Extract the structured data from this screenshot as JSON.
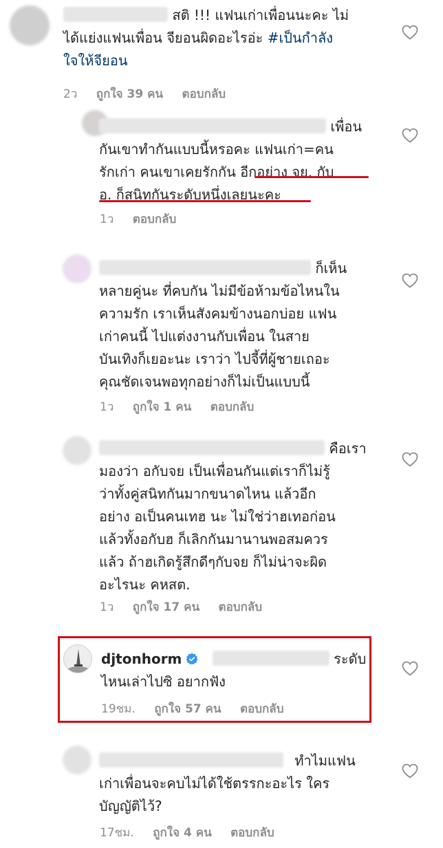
{
  "comments": [
    {
      "lines": [
        "สติ !!! แฟนเก่าเพื่อนนะคะ ไม่",
        "ได้แย่งแฟนเพื่อน จียอนผิดอะไรอ่ะ",
        "ใจให้จียอน"
      ],
      "hashtag": "#เป็นกำลัง",
      "time": "2ว",
      "likes": "ถูกใจ 39 คน",
      "reply": "ตอบกลับ"
    },
    {
      "lines": [
        "เพื่อน",
        "กันเขาทำกันแบบนี้หรอคะ แฟนเก่า=คน",
        "รักเก่า คนเขาเคยรักกัน",
        "อีกอย่าง จย. กับ",
        "อ. ก็สนิทกันระดับหนึ่งเลยนะคะ"
      ],
      "time": "1ว",
      "reply": "ตอบกลับ"
    },
    {
      "lines": [
        "ก็เห็น",
        "หลายคู่นะ ที่คบกัน  ไม่มีข้อห้ามข้อไหนใน",
        "ความรัก  เราเห็นสังคมข้างนอกบ่อย แฟน",
        "เก่าคนนี้ ไปแต่งงานกับเพื่อน  ในสาย",
        "บันเทิงก็เยอะนะ  เราว่า ไปจี้ที่ผู้ชายเถอะ",
        "คุณชัดเจนพอทุกอย่างก็ไม่เป็นแบบนี้"
      ],
      "time": "1ว",
      "likes": "ถูกใจ 1 คน",
      "reply": "ตอบกลับ"
    },
    {
      "lines": [
        "คือเรา",
        "มองว่า อกับจย เป็นเพื่อนกันแต่เราก็ไม่รู้",
        "ว่าทั้งคู่สนิทกันมากขนาดไหน แล้วอีก",
        "อย่าง อเป็นคนเทฮ นะ ไม่ใช่ว่าฮเทอก่อน",
        "แล้วทั้งอกับฮ ก็เลิกกันมานานพอสมควร",
        "แล้ว ถ้าฮเกิดรู้สึกดีๆกับจย ก็ไม่น่าจะผิด",
        "อะไรนะ คหสต."
      ],
      "time": "1ว",
      "likes": "ถูกใจ 17 คน",
      "reply": "ตอบกลับ"
    },
    {
      "username": "djtonhorm",
      "lines": [
        "ระดับ",
        "ไหนเล่าไปซิ อยากฟัง"
      ],
      "time": "19ชม.",
      "likes": "ถูกใจ 57 คน",
      "reply": "ตอบกลับ"
    },
    {
      "lines": [
        "ทำไมแฟน",
        "เก่าเพื่อนจะคบไม่ได้ใช้ตรรกะอะไร ใคร",
        "บัญญัติไว้?"
      ],
      "time": "17ชม.",
      "likes": "ถูกใจ 4 คน",
      "reply": "ตอบกลับ"
    }
  ],
  "icons": {
    "like": "heart-outline-icon",
    "verified": "verified-badge-icon"
  },
  "colors": {
    "highlight": "#d0101a",
    "hashtag": "#00376b",
    "meta": "#8e8e8e",
    "verified": "#3897f0"
  }
}
